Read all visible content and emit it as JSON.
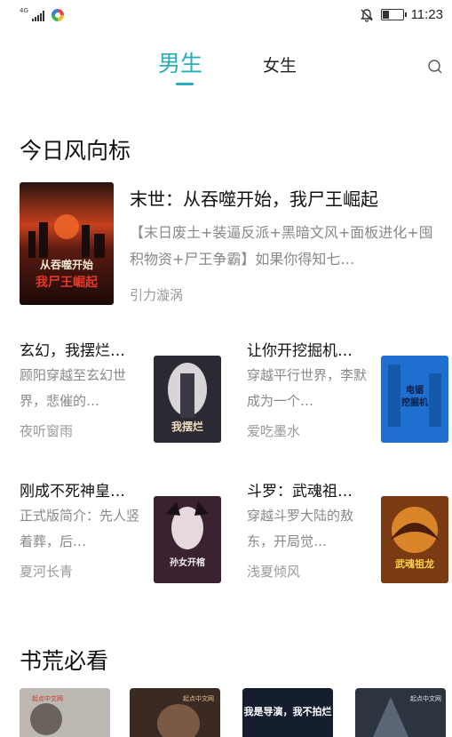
{
  "status_bar": {
    "network": "4G",
    "time": "11:23",
    "battery_level": 0.35,
    "icons": [
      "signal-icon",
      "app-icon",
      "mute-bell-icon",
      "battery-icon"
    ]
  },
  "tabs": {
    "male": "男生",
    "female": "女生",
    "active": "male",
    "accent_color": "#27aeb8"
  },
  "search": {
    "icon": "search-icon"
  },
  "section_trending": {
    "title": "今日风向标",
    "featured": {
      "title": "末世：从吞噬开始，我尸王崛起",
      "desc": "【末日废土+装逼反派+黑暗文风+面板进化+囤积物资+尸王争霸】如果你得知七…",
      "author": "引力漩涡",
      "cover_text": "从吞噬开始 我尸王崛起"
    },
    "books": [
      {
        "title": "玄幻，我摆烂…",
        "desc": "顾阳穿越至玄幻世界，悲催的…",
        "author": "夜听窗雨",
        "cover_text": "我摆烂"
      },
      {
        "title": "让你开挖掘机…",
        "desc": "穿越平行世界，李默成为一个…",
        "author": "爱吃墨水",
        "cover_text": "电锯挖掘机"
      },
      {
        "title": "刚成不死神皇…",
        "desc": "正式版简介：先人竖着葬，后…",
        "author": "夏河长青",
        "cover_text": "孙女开棺"
      },
      {
        "title": "斗罗：武魂祖…",
        "desc": "穿越斗罗大陆的敖东，开局觉…",
        "author": "浅夏倾风",
        "cover_text": "武魂祖龙"
      }
    ]
  },
  "section_must_read": {
    "title": "书荒必看",
    "covers": [
      {
        "label": "起点中文网"
      },
      {
        "label": "起点中文网"
      },
      {
        "label": "我是导演，我不拍烂"
      },
      {
        "label": "起点中文网"
      }
    ]
  }
}
